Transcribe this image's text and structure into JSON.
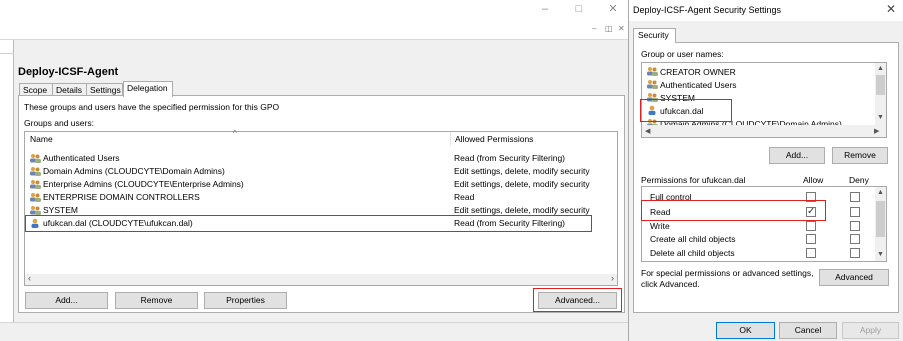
{
  "gpo": {
    "name": "Deploy-ICSF-Agent",
    "tabs": [
      "Scope",
      "Details",
      "Settings",
      "Delegation"
    ],
    "active_tab": "Delegation",
    "description": "These groups and users have the specified permission for this GPO",
    "groups_label": "Groups and users:",
    "columns": {
      "name": "Name",
      "permissions": "Allowed Permissions"
    },
    "rows": [
      {
        "name": "Authenticated Users",
        "permission": "Read (from Security Filtering)",
        "icon": "group-icon"
      },
      {
        "name": "Domain Admins (CLOUDCYTE\\Domain Admins)",
        "permission": "Edit settings, delete, modify security",
        "icon": "group-icon"
      },
      {
        "name": "Enterprise Admins (CLOUDCYTE\\Enterprise Admins)",
        "permission": "Edit settings, delete, modify security",
        "icon": "group-icon"
      },
      {
        "name": "ENTERPRISE DOMAIN CONTROLLERS",
        "permission": "Read",
        "icon": "group-icon"
      },
      {
        "name": "SYSTEM",
        "permission": "Edit settings, delete, modify security",
        "icon": "group-icon"
      },
      {
        "name": "ufukcan.dal (CLOUDCYTE\\ufukcan.dal)",
        "permission": "Read (from Security Filtering)",
        "icon": "user-icon"
      }
    ],
    "buttons": {
      "add": "Add...",
      "remove": "Remove",
      "properties": "Properties",
      "advanced": "Advanced..."
    }
  },
  "security_dialog": {
    "title": "Deploy-ICSF-Agent Security Settings",
    "tab": "Security",
    "groups_label": "Group or user names:",
    "groups": [
      {
        "name": "CREATOR OWNER",
        "icon": "group-icon"
      },
      {
        "name": "Authenticated Users",
        "icon": "group-icon"
      },
      {
        "name": "SYSTEM",
        "icon": "group-icon"
      },
      {
        "name": "ufukcan.dal",
        "icon": "user-icon"
      },
      {
        "name": "Domain Admins (CLOUDCYTE\\Domain Admins)",
        "icon": "group-icon"
      }
    ],
    "add_button": "Add...",
    "remove_button": "Remove",
    "permissions_label": "Permissions for ufukcan.dal",
    "allow_label": "Allow",
    "deny_label": "Deny",
    "permissions": [
      {
        "name": "Full control",
        "allow": false,
        "deny": false
      },
      {
        "name": "Read",
        "allow": true,
        "deny": false
      },
      {
        "name": "Write",
        "allow": false,
        "deny": false
      },
      {
        "name": "Create all child objects",
        "allow": false,
        "deny": false
      },
      {
        "name": "Delete all child objects",
        "allow": false,
        "deny": false
      }
    ],
    "special_text_line1": "For special permissions or advanced settings,",
    "special_text_line2": "click Advanced.",
    "advanced_button": "Advanced",
    "ok_button": "OK",
    "cancel_button": "Cancel",
    "apply_button": "Apply"
  },
  "colors": {
    "highlight": "#e0201f",
    "focus": "#0078d7"
  }
}
